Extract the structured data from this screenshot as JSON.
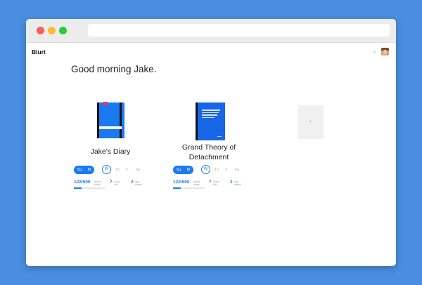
{
  "app": {
    "brand": "Blurt",
    "greeting": "Good morning Jake."
  },
  "colors": {
    "accent": "#1a7af2",
    "background": "#4a8ee0"
  },
  "journals": [
    {
      "title": "Jake's Diary",
      "days": [
        "Su",
        "M",
        "W",
        "Th",
        "F",
        "Sa"
      ],
      "words": "122/500",
      "words_caption": "words today",
      "words_progress": 0.244,
      "hours": "7",
      "hours_caption": "hours left",
      "streak": "2",
      "streak_caption": "day streak"
    },
    {
      "title": "Grand Theory of Detachment",
      "days": [
        "Su",
        "M",
        "W",
        "Th",
        "F",
        "Sa"
      ],
      "words": "122/500",
      "words_caption": "words today",
      "words_progress": 0.244,
      "hours": "7",
      "hours_caption": "hours left",
      "streak": "2",
      "streak_caption": "day streak"
    }
  ],
  "add_card": {
    "label": "+"
  },
  "icons": {
    "avatar": "user-avatar",
    "window_controls": [
      "close",
      "minimize",
      "maximize"
    ]
  }
}
